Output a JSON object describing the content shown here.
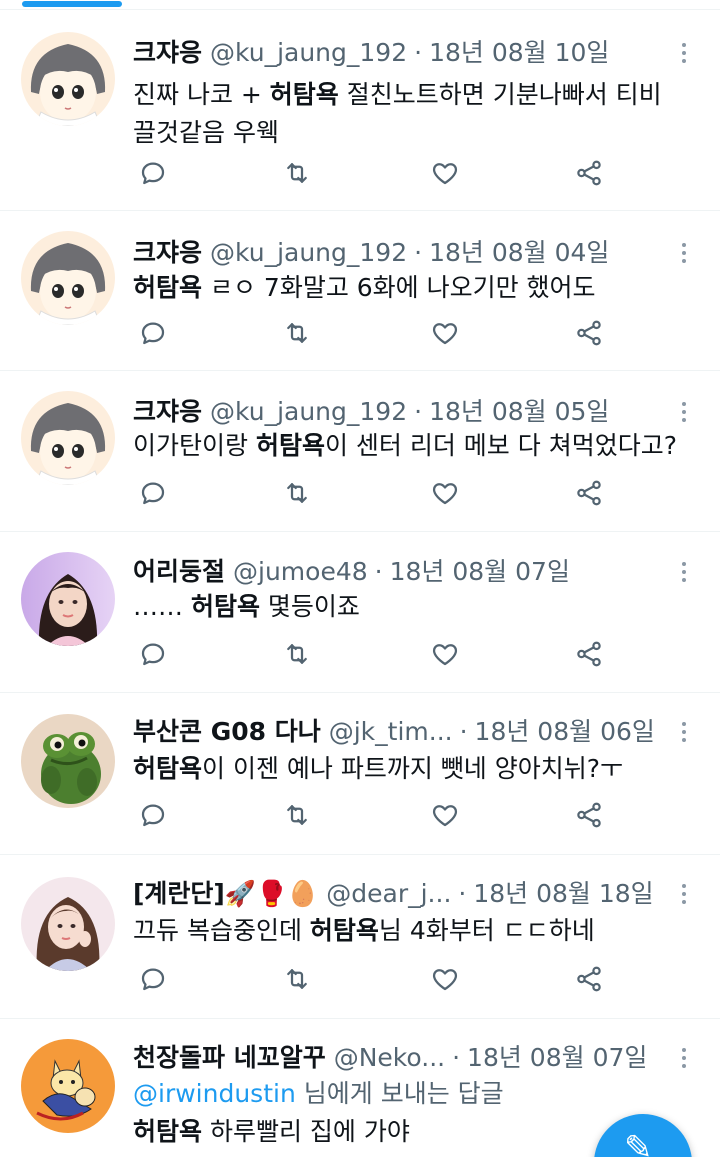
{
  "colors": {
    "accent": "#1d9bf0",
    "text": "#0f1419",
    "muted": "#536471",
    "divider": "#eff3f4"
  },
  "icons": {
    "reply": "reply-icon",
    "retweet": "retweet-icon",
    "like": "heart-icon",
    "share": "share-icon",
    "more": "more-vertical-icon",
    "compose": "compose-tweet-icon"
  },
  "tweets": [
    {
      "name": "크쟈응",
      "handle": "@ku_jaung_192",
      "sep": "·",
      "date": "18년 08월 10일",
      "avatar": "avatar-anime-girl",
      "reply_to": "",
      "text": [
        {
          "t": "진짜 나코 + ",
          "b": false
        },
        {
          "t": "허탐욕",
          "b": true
        },
        {
          "t": " 절친노트하면 기분나빠서 티비 끌것같음 우웩",
          "b": false
        }
      ]
    },
    {
      "name": "크쟈응",
      "handle": "@ku_jaung_192",
      "sep": "·",
      "date": "18년 08월 04일",
      "avatar": "avatar-anime-girl",
      "reply_to": "",
      "text": [
        {
          "t": "허탐욕",
          "b": true
        },
        {
          "t": " ㄹㅇ 7화말고 6화에 나오기만 했어도",
          "b": false
        }
      ]
    },
    {
      "name": "크쟈응",
      "handle": "@ku_jaung_192",
      "sep": "·",
      "date": "18년 08월 05일",
      "avatar": "avatar-anime-girl",
      "reply_to": "",
      "text": [
        {
          "t": "이가탄이랑 ",
          "b": false
        },
        {
          "t": "허탐욕",
          "b": true
        },
        {
          "t": "이 센터 리더 메보 다 쳐먹었다고?",
          "b": false
        }
      ]
    },
    {
      "name": "어리둥절",
      "handle": "@jumoe48",
      "sep": "·",
      "date": "18년 08월 07일",
      "avatar": "avatar-photo-girl",
      "reply_to": "",
      "text": [
        {
          "t": "…… ",
          "b": false
        },
        {
          "t": "허탐욕",
          "b": true
        },
        {
          "t": " 몇등이죠",
          "b": false
        }
      ]
    },
    {
      "name": "부산콘 G08 다나",
      "handle": "@jk_tim...",
      "sep": "·",
      "date": "18년 08월 06일",
      "avatar": "avatar-green-frog",
      "reply_to": "",
      "text": [
        {
          "t": "허탐욕",
          "b": true
        },
        {
          "t": "이 이젠 예나 파트까지 뺏네 양아치뉘?ㅜ",
          "b": false
        }
      ]
    },
    {
      "name": "[계란단]🚀🥊🥚",
      "handle": "@dear_j...",
      "sep": "·",
      "date": "18년 08월 18일",
      "avatar": "avatar-photo-girl-2",
      "reply_to": "",
      "text": [
        {
          "t": "끄듀 복습중인데 ",
          "b": false
        },
        {
          "t": "허탐욕",
          "b": true
        },
        {
          "t": "님 4화부터 ㄷㄷ하네",
          "b": false
        }
      ]
    },
    {
      "name": "천장돌파 네꼬알꾸",
      "handle": "@Neko...",
      "sep": "·",
      "date": "18년 08월 07일",
      "avatar": "avatar-cartoon-cats",
      "reply_to": {
        "mention": "@irwindustin",
        "suffix": " 님에게 보내는 답글"
      },
      "text": [
        {
          "t": "허탐욕",
          "b": true
        },
        {
          "t": " 하루빨리 집에 가야",
          "b": false
        }
      ]
    }
  ]
}
